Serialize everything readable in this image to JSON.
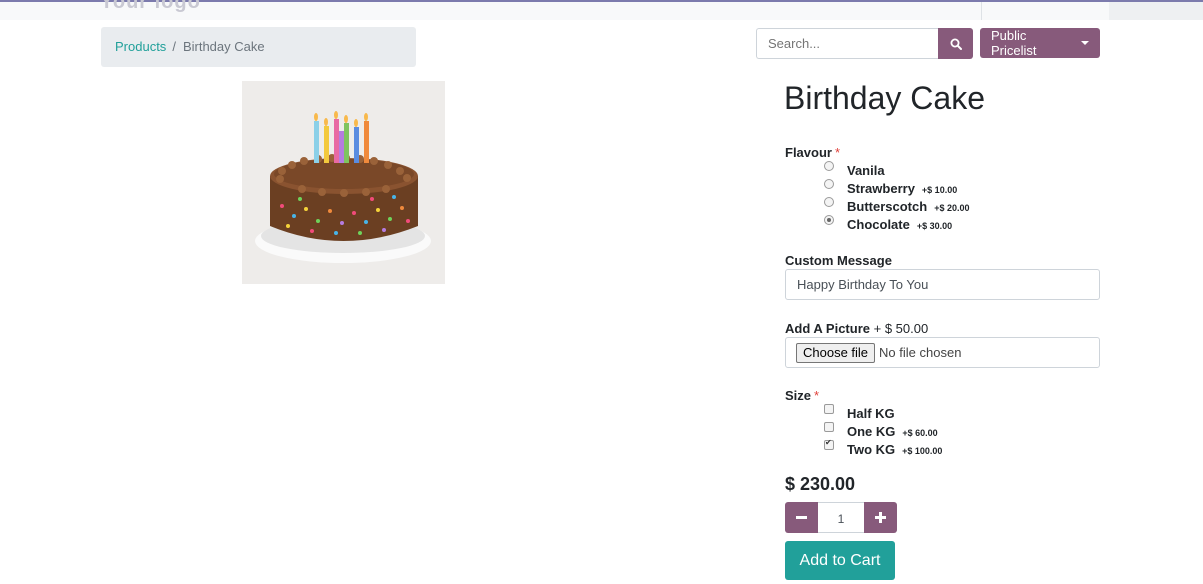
{
  "header": {
    "logo_text": "Your logo"
  },
  "breadcrumb": {
    "products": "Products",
    "separator": "/",
    "current": "Birthday Cake"
  },
  "search": {
    "placeholder": "Search...",
    "icon": "search-icon"
  },
  "pricelist": {
    "label": "Public Pricelist"
  },
  "product": {
    "title": "Birthday Cake",
    "image_alt": "birthday cake with candles"
  },
  "flavour": {
    "label": "Flavour",
    "required_mark": "*",
    "options": [
      {
        "label": "Vanila",
        "price": "",
        "checked": false
      },
      {
        "label": "Strawberry",
        "price": "+$ 10.00",
        "checked": false
      },
      {
        "label": "Butterscotch",
        "price": "+$ 20.00",
        "checked": false
      },
      {
        "label": "Chocolate",
        "price": "+$ 30.00",
        "checked": true
      }
    ]
  },
  "custom_message": {
    "label": "Custom Message",
    "value": "Happy Birthday To You"
  },
  "picture": {
    "label": "Add A Picture",
    "extra": "+ $ 50.00",
    "button": "Choose file",
    "status": "No file chosen"
  },
  "size": {
    "label": "Size",
    "required_mark": "*",
    "options": [
      {
        "label": "Half KG",
        "price": "",
        "checked": false
      },
      {
        "label": "One KG",
        "price": "+$ 60.00",
        "checked": false
      },
      {
        "label": "Two KG",
        "price": "+$ 100.00",
        "checked": true
      }
    ]
  },
  "price": "$ 230.00",
  "quantity": {
    "minus": "−",
    "value": "1",
    "plus": "+"
  },
  "cart": {
    "label": "Add to Cart"
  },
  "colors": {
    "primary": "#875a7b",
    "accent": "#21a09a",
    "required": "#e0413b"
  }
}
